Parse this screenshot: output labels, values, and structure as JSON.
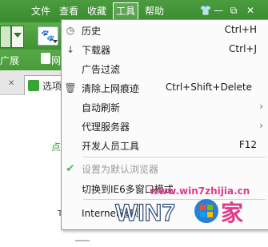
{
  "menubar": {
    "items": [
      {
        "label": "文件"
      },
      {
        "label": "查看"
      },
      {
        "label": "收藏"
      },
      {
        "label": "工具"
      },
      {
        "label": "帮助"
      }
    ],
    "active": "工具",
    "window_icons": [
      "shirt-icon",
      "minimize-icon",
      "restore-icon",
      "close-icon"
    ]
  },
  "favbar": {
    "left_text": "广展",
    "partial_text": "网"
  },
  "tabs": [
    {
      "label": "选项"
    }
  ],
  "content": {
    "fragment": "点",
    "fragment2": "Tea"
  },
  "tools_menu": {
    "items": [
      {
        "label": "历史",
        "shortcut": "Ctrl+H",
        "icon": "history-clock-icon"
      },
      {
        "label": "下载器",
        "shortcut": "Ctrl+J",
        "icon": "download-arrow-icon"
      },
      {
        "label": "广告过滤",
        "shortcut": "",
        "icon": ""
      },
      {
        "label": "清除上网痕迹",
        "shortcut": "Ctrl+Shift+Delete",
        "icon": "trash-icon"
      },
      {
        "label": "自动刷新",
        "shortcut": "",
        "icon": "",
        "submenu": true
      },
      {
        "label": "代理服务器",
        "shortcut": "",
        "icon": "",
        "submenu": true
      },
      {
        "label": "开发人员工具",
        "shortcut": "F12",
        "icon": ""
      },
      {
        "label": "设置为默认浏览器",
        "shortcut": "",
        "icon": "checkmark-icon",
        "disabled": true
      },
      {
        "label": "切换到IE6多窗口模式",
        "shortcut": "",
        "icon": ""
      },
      {
        "label": "Internet选项",
        "shortcut": "",
        "icon": ""
      }
    ]
  },
  "watermark": {
    "url": "www.win7zhijia.cn",
    "logo_text": "WIN7",
    "logo_suffix": "家"
  },
  "colors": {
    "toolbar_green": "#3f9133",
    "watermark_pink": "#e03b8b",
    "checkmark_green": "#5bb85b"
  }
}
